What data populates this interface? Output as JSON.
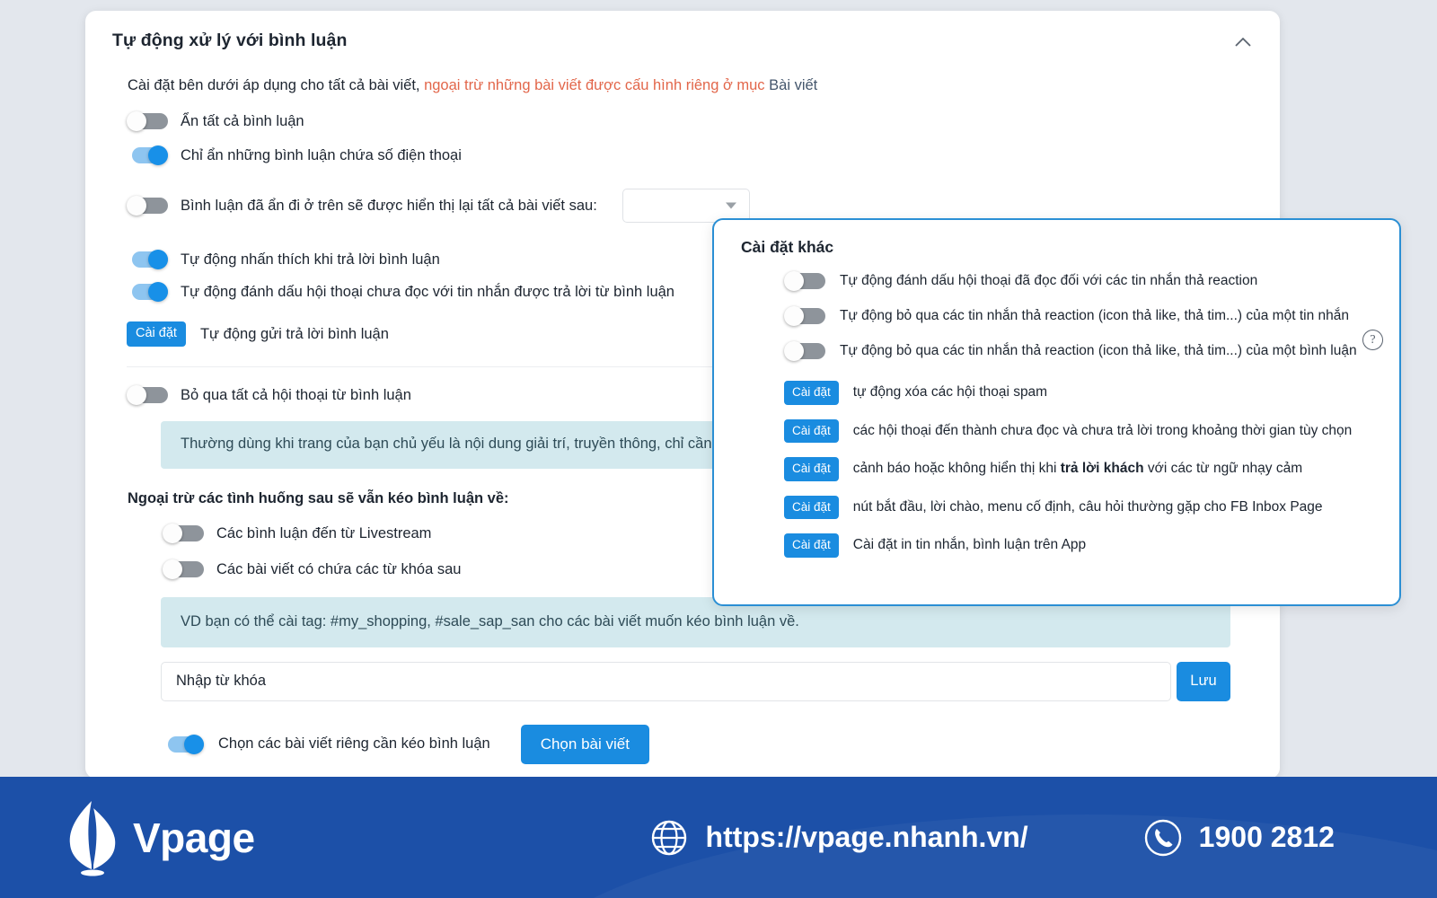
{
  "card": {
    "title": "Tự động xử lý với bình luận",
    "collapse_icon": "chevron-up-icon",
    "intro": {
      "prefix": "Cài đặt bên dưới áp dụng cho tất cả bài viết, ",
      "highlight": "ngoại trừ những bài viết được cấu hình riêng ở mục",
      "link": " Bài viết",
      "highlight_color": "#e2664a",
      "link_color": "#44566c"
    },
    "toggles": {
      "hide_all_comments": {
        "label": "Ẩn tất cả bình luận",
        "on": false
      },
      "hide_phone_comments": {
        "label": "Chỉ ẩn những bình luận chứa số điện thoại",
        "on": true
      },
      "reshow_hidden": {
        "label": "Bình luận đã ẩn đi ở trên sẽ được hiển thị lại tất cả bài viết sau:",
        "on": false
      },
      "auto_like_reply": {
        "label": "Tự động nhấn thích khi trả lời bình luận",
        "on": true
      },
      "mark_unread": {
        "label": "Tự động đánh dấu hội thoại chưa đọc với tin nhắn được trả lời từ bình luận",
        "on": true
      },
      "skip_all_conversations": {
        "label": "Bỏ qua tất cả hội thoại từ bình luận",
        "on": false
      },
      "livestream_comments": {
        "label": "Các bình luận đến từ Livestream",
        "on": false
      },
      "keyword_posts": {
        "label": "Các bài viết có chứa các từ khóa sau",
        "on": false
      },
      "choose_specific_posts": {
        "label": "Chọn các bài viết riêng cần kéo bình luận",
        "on": true
      }
    },
    "reshow_select": {
      "value": "",
      "caret_icon": "chevron-down-icon"
    },
    "auto_reply_row": {
      "button": "Cài đặt",
      "text": "Tự động gửi trả lời bình luận"
    },
    "info_box": "Thường dùng khi trang của bạn chủ yếu là nội dung giải trí, truyền thông, chỉ cần tương tác với khách ngay tại bình luận.",
    "section_head": "Ngoại trừ các tình huống sau sẽ vẫn kéo bình luận về:",
    "tag_info_box": "VD bạn có thể cài tag: #my_shopping, #sale_sap_san cho các bài viết muốn kéo bình luận về.",
    "keyword_input": {
      "placeholder": "Nhập từ khóa",
      "value": ""
    },
    "save_button": "Lưu",
    "choose_posts_button": "Chọn bài viết"
  },
  "overlay": {
    "title": "Cài đặt khác",
    "help_icon": "question-mark-icon",
    "toggles": [
      {
        "label": "Tự động đánh dấu hội thoại đã đọc đối với các tin nhắn thả reaction",
        "on": false
      },
      {
        "label": "Tự động bỏ qua các tin nhắn thả reaction (icon thả like, thả tim...) của một tin nhắn",
        "on": false
      },
      {
        "label": "Tự động bỏ qua các tin nhắn thả reaction (icon thả like, thả tim...) của một bình luận",
        "on": false
      }
    ],
    "actions": [
      {
        "button": "Cài đặt",
        "text": "tự động xóa các hội thoại spam",
        "bold": ""
      },
      {
        "button": "Cài đặt",
        "text": "các hội thoại đến thành chưa đọc và chưa trả lời trong khoảng thời gian tùy chọn",
        "bold": ""
      },
      {
        "button": "Cài đặt",
        "text_before": "cảnh báo hoặc không hiển thị khi ",
        "bold": "trả lời khách",
        "text_after": " với các từ ngữ nhạy cảm"
      },
      {
        "button": "Cài đặt",
        "text": "nút bắt đầu, lời chào, menu cố định, câu hỏi thường gặp cho FB Inbox Page",
        "bold": ""
      },
      {
        "button": "Cài đặt",
        "text": "Cài đặt in tin nhắn, bình luận trên App",
        "bold": ""
      }
    ]
  },
  "footer": {
    "brand": "Vpage",
    "logo_icon": "vpage-leaf-logo",
    "globe_icon": "globe-icon",
    "url": "https://vpage.nhanh.vn/",
    "phone_icon": "phone-circle-icon",
    "phone": "1900 2812",
    "background_color": "#1c50a8"
  }
}
